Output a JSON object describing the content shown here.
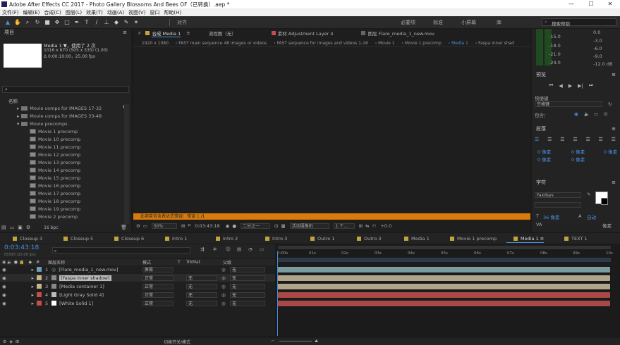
{
  "titlebar": {
    "title": "Adobe After Effects CC 2017 - Photo Gallery Blossoms And Bees OF（已转换）.aep *",
    "min": "—",
    "max": "☐",
    "close": "✕"
  },
  "menu": [
    "文件(F)",
    "编辑(E)",
    "合成(C)",
    "图层(L)",
    "效果(T)",
    "动画(A)",
    "视图(V)",
    "窗口",
    "帮助(H)"
  ],
  "toolbar": {
    "align": "对齐",
    "workspaces": [
      "必要项",
      "标准",
      "小屏幕",
      "库"
    ],
    "search": "搜索帮助"
  },
  "project": {
    "title": "项目",
    "item_name": "Media 1 ▼，使用了 2 次",
    "info1": "1016 x 670 (505 x 335) (1.00)",
    "info2": "Δ 0:00:10:00，25.00 fps",
    "name_col": "名称",
    "bpc": "16 bpc",
    "items": [
      {
        "name": "Movie comps for IMAGES 17-32",
        "type": "folder",
        "open": false
      },
      {
        "name": "Movie comps for IMAGES 33-48",
        "type": "folder",
        "open": false
      },
      {
        "name": "Movie precomps",
        "type": "folder",
        "open": true
      },
      {
        "name": "Movie 1 precomp",
        "type": "comp"
      },
      {
        "name": "Movie 10 precomp",
        "type": "comp"
      },
      {
        "name": "Movie 11 precomp",
        "type": "comp"
      },
      {
        "name": "Movie 12 precomp",
        "type": "comp"
      },
      {
        "name": "Movie 13 precomp",
        "type": "comp"
      },
      {
        "name": "Movie 14 precomp",
        "type": "comp"
      },
      {
        "name": "Movie 15 precomp",
        "type": "comp"
      },
      {
        "name": "Movie 16 precomp",
        "type": "comp"
      },
      {
        "name": "Movie 17 precomp",
        "type": "comp"
      },
      {
        "name": "Movie 18 precomp",
        "type": "comp"
      },
      {
        "name": "Movie 19 precomp",
        "type": "comp"
      },
      {
        "name": "Movie 2 precomp",
        "type": "comp"
      }
    ]
  },
  "viewer": {
    "comp_tab": "合成 Media 1",
    "ly_tab": "流程图（无）",
    "footage_tab": "素材 Adjustment Layer 4",
    "layer_tab": "图层 Flare_media_1_new.mov",
    "crumbs": [
      "1920 x 1080",
      "FAST main sequence 48 images or videos",
      "FAST sequence for images and videos 1-16",
      "Movie 1",
      "Movie 1 precomp",
      "Media 1",
      "Faspa inner shad"
    ],
    "warning": "此项目包含表达式错误：错误 1 /1",
    "zoom": "50%",
    "timecode": "0:03:43:18",
    "res": "二分之一",
    "camera": "活动摄像机",
    "views": "1 个...",
    "exposure": "+0.0"
  },
  "audio": {
    "levels": [
      "-15.0",
      "-18.0",
      "-21.0",
      "-24.0"
    ],
    "right_levels": [
      "-3.0",
      "-6.0",
      "-9.0",
      "-12.0 dB"
    ],
    "top_right": "0.0"
  },
  "preview": {
    "title": "预览",
    "shortcut_label": "快捷键",
    "shortcut": "空格键",
    "include": "包含："
  },
  "paragraph": {
    "title": "段落",
    "v1": "0 像素",
    "v2": "0 像素",
    "v3": "0 像素",
    "v4": "0 像素",
    "v5": "0 像素"
  },
  "character": {
    "title": "字符",
    "font": "Faxdsys",
    "size": "36 像素",
    "auto": "自动",
    "tracking": "像素"
  },
  "timeline": {
    "tabs": [
      {
        "name": "Closeup 3",
        "color": "#c4a33a"
      },
      {
        "name": "Closeup 5",
        "color": "#c4a33a"
      },
      {
        "name": "Closeup 6",
        "color": "#c4a33a"
      },
      {
        "name": "Intro 1",
        "color": "#c4a33a"
      },
      {
        "name": "Intro 2",
        "color": "#c4a33a"
      },
      {
        "name": "Intro 3",
        "color": "#c4a33a"
      },
      {
        "name": "Outro 1",
        "color": "#c4a33a"
      },
      {
        "name": "Outro 3",
        "color": "#c4a33a"
      },
      {
        "name": "Media 1",
        "color": "#c4a33a"
      },
      {
        "name": "Movie 1 precomp",
        "color": "#c4a33a"
      },
      {
        "name": "Media 1",
        "color": "#c4a33a",
        "active": true
      },
      {
        "name": "TEXT 1",
        "color": "#c4a33a"
      }
    ],
    "timecode": "0:03:43:18",
    "subtc": "05593 (25.00 fps)",
    "col_name": "图层名称",
    "col_mode": "模式",
    "col_t": "T",
    "col_trk": "TrkMat",
    "col_parent": "父级",
    "ruler": [
      "0:00s",
      "01s",
      "02s",
      "03s",
      "04s",
      "05s",
      "06s",
      "07s",
      "08s",
      "09s",
      "10s"
    ],
    "bottom": "切换开关/模式",
    "layers": [
      {
        "num": "1",
        "name": "[Flare_media_1_new.mov]",
        "mode": "屏幕",
        "trk": "",
        "parent": "无",
        "label": "#6f9fb6",
        "bar": "#7a9c9e"
      },
      {
        "num": "2",
        "name": "[Faspa inner shadow]",
        "mode": "正常",
        "trk": "无",
        "parent": "无",
        "label": "#c9b48a",
        "bar": "#b0a58a",
        "selected": true
      },
      {
        "num": "3",
        "name": "[Media container 1]",
        "mode": "正常",
        "trk": "无",
        "parent": "无",
        "label": "#c9b48a",
        "bar": "#b0a58a"
      },
      {
        "num": "4",
        "name": "[Light Gray Solid 4]",
        "mode": "正常",
        "trk": "无",
        "parent": "无",
        "label": "#c94b4b",
        "bar": "#a84848"
      },
      {
        "num": "5",
        "name": "[White Solid 1]",
        "mode": "正常",
        "trk": "无",
        "parent": "无",
        "label": "#c94b4b",
        "bar": "#a84848"
      }
    ]
  }
}
